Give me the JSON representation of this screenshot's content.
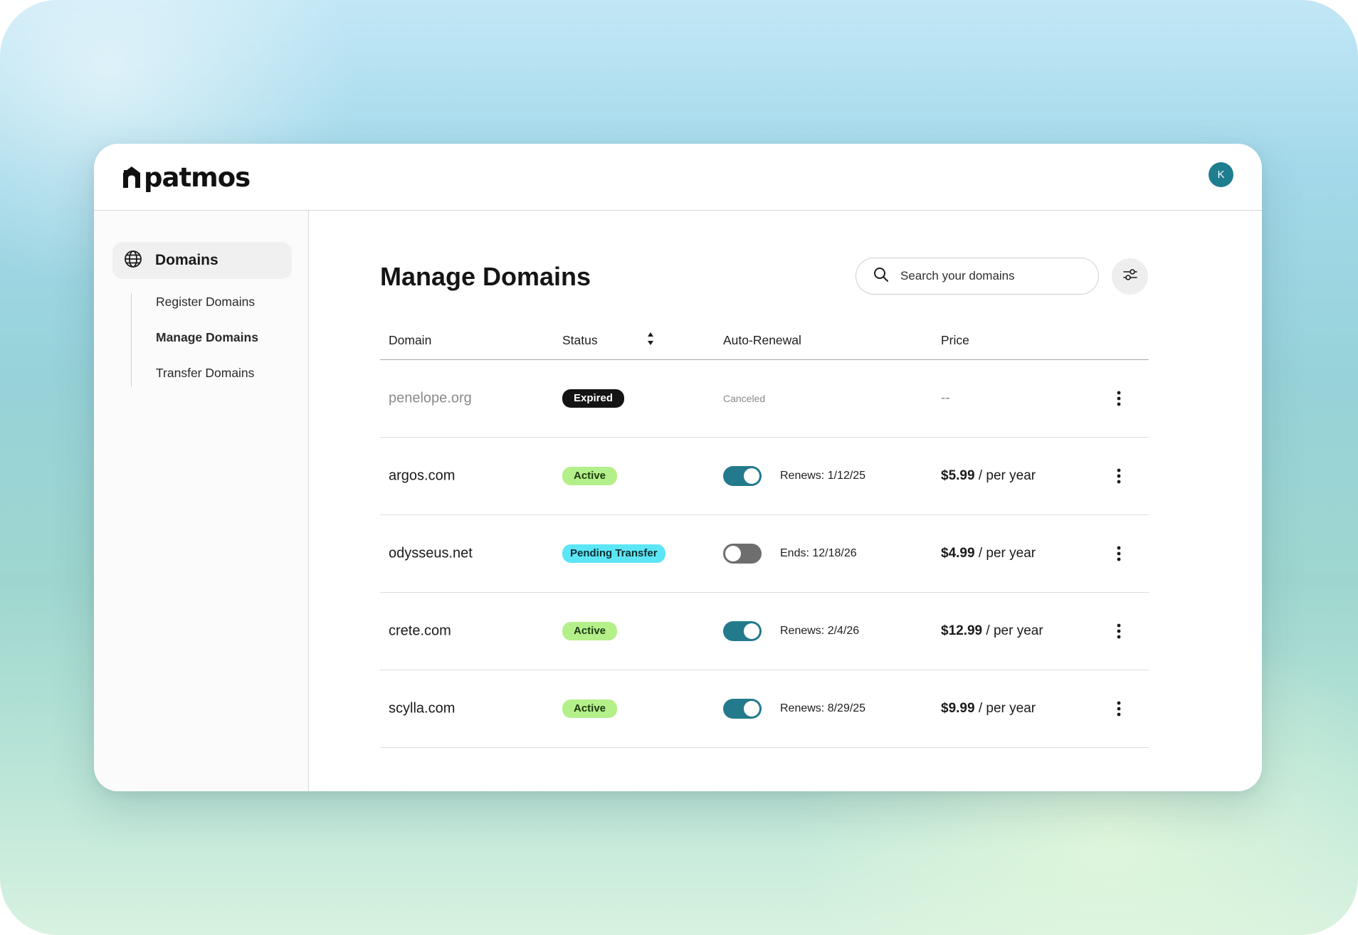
{
  "brand": {
    "name": "patmos"
  },
  "user": {
    "initial": "K"
  },
  "sidebar": {
    "primary": {
      "label": "Domains",
      "icon": "globe-icon"
    },
    "items": [
      {
        "label": "Register Domains",
        "active": false
      },
      {
        "label": "Manage Domains",
        "active": true
      },
      {
        "label": "Transfer Domains",
        "active": false
      }
    ]
  },
  "main": {
    "title": "Manage Domains",
    "search": {
      "placeholder": "Search your domains",
      "value": ""
    }
  },
  "table": {
    "columns": [
      "Domain",
      "Status",
      "Auto-Renewal",
      "Price"
    ],
    "rows": [
      {
        "domain": "penelope.org",
        "status": "Expired",
        "renewal": "Canceled",
        "price": "--",
        "price_unit": ""
      },
      {
        "domain": "argos.com",
        "status": "Active",
        "renewal": "Renews: 1/12/25",
        "price": "$5.99",
        "price_unit": " / per year"
      },
      {
        "domain": "odysseus.net",
        "status": "Pending Transfer",
        "renewal": "Ends: 12/18/26",
        "price": "$4.99",
        "price_unit": " / per year"
      },
      {
        "domain": "crete.com",
        "status": "Active",
        "renewal": "Renews: 2/4/26",
        "price": "$12.99",
        "price_unit": " / per year"
      },
      {
        "domain": "scylla.com",
        "status": "Active",
        "renewal": "Renews: 8/29/25",
        "price": "$9.99",
        "price_unit": " / per year"
      }
    ]
  },
  "colors": {
    "accent": "#1e7d8f",
    "active_badge": "#b4f08a",
    "pending_badge": "#5ce6f5",
    "expired_badge": "#141414",
    "toggle_on": "#237a8c",
    "toggle_off": "#6e6e6e"
  }
}
